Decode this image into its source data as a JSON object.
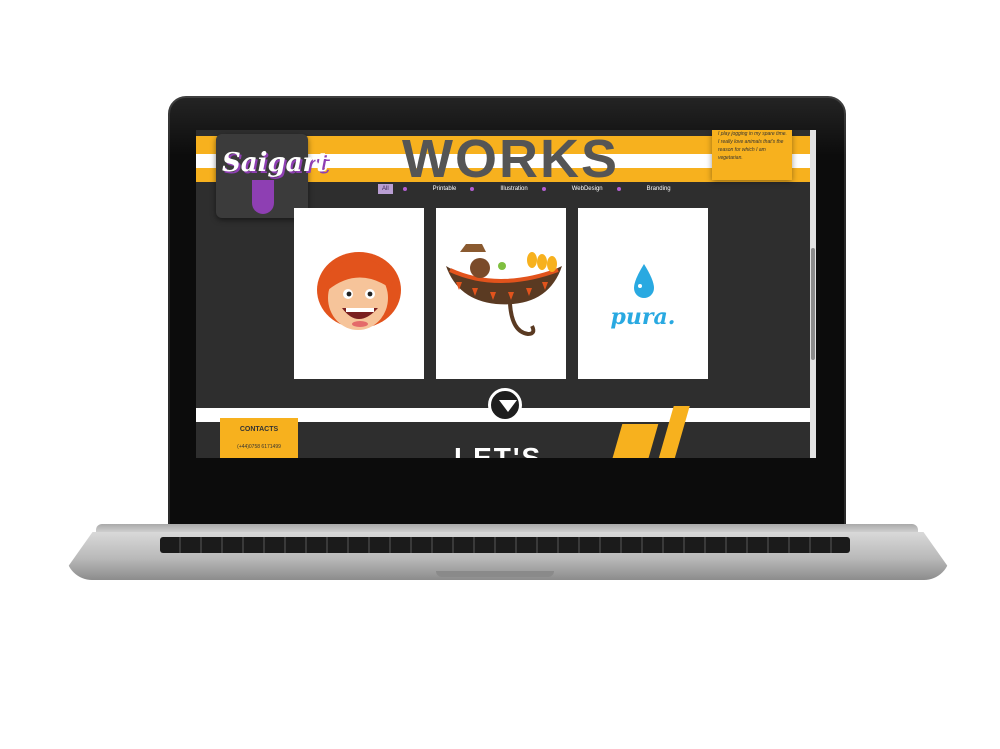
{
  "page": {
    "title": "WORKS",
    "logo_text": "Saigart",
    "about_text": "I play jogging in my spare time. I really love animals that's the reason for which I am vegetarian."
  },
  "filters": [
    {
      "label": "All",
      "active": true
    },
    {
      "label": "Printable",
      "active": false
    },
    {
      "label": "Illustration",
      "active": false
    },
    {
      "label": "WebDesign",
      "active": false
    },
    {
      "label": "Branding",
      "active": false
    }
  ],
  "cards": [
    {
      "name": "girl-illustration"
    },
    {
      "name": "animal-illustration"
    },
    {
      "name": "pura-logo",
      "text": "pura."
    }
  ],
  "contacts": {
    "title": "CONTACTS",
    "phone": "(+44)0758 6171499"
  },
  "section_next": {
    "heading": "LET'S"
  },
  "colors": {
    "accent": "#f7b11e",
    "purple": "#8e3fb3",
    "dark": "#2e2e2e",
    "pura_blue": "#29a9e1"
  }
}
